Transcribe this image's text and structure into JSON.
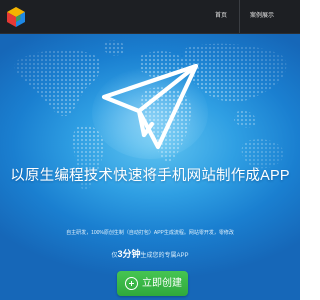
{
  "header": {
    "logo_icon": "cube-logo-icon",
    "nav": [
      {
        "label": "首页"
      },
      {
        "label": "案例展示"
      }
    ]
  },
  "hero": {
    "map_icon": "world-map-icon",
    "plane_icon": "paper-plane-icon",
    "headline": "以原生编程技术快速将手机网站制作成APP",
    "subline": "自主研发，100%原创生制（自动打包）APP生成流程。网站零开发，零修改",
    "time_prefix": "仅",
    "time_number": "3分钟",
    "time_suffix": "生成您的专属APP",
    "cta_label": "立即创建",
    "cta_icon": "plus-circle-icon"
  },
  "colors": {
    "topbar": "#1d1f23",
    "hero_blue": "#2f9fe3",
    "cta_green": "#3bb748"
  }
}
